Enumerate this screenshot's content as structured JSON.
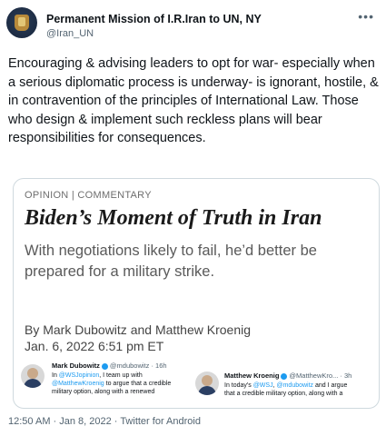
{
  "header": {
    "display_name": "Permanent Mission of I.R.Iran to UN, NY",
    "handle": "@Iran_UN",
    "more_icon": "more-horizontal-icon"
  },
  "tweet": {
    "text": "Encouraging & advising leaders to opt for war- especially when a serious diplomatic process is underway- is ignorant, hostile, & in contravention of the principles of International Law. Those who design & implement such reckless plans will bear responsibilities for consequences."
  },
  "article": {
    "section": "OPINION | COMMENTARY",
    "headline": "Biden’s Moment of Truth in Iran",
    "deck": "With negotiations likely to fail, he’d better be prepared for a military strike.",
    "byline": "By Mark Dubowitz and Matthew Kroenig",
    "date": "Jan. 6, 2022 6:51 pm ET"
  },
  "embedded": [
    {
      "name": "Mark Dubowitz",
      "meta": "@mdubowitz · 16h",
      "line1_pre": "In ",
      "line1_mention": "@WSJopinion",
      "line1_post": ", I team up with",
      "line2_mention": "@MatthewKroenig",
      "line2_post": " to argue that a credible",
      "line3": "military option, along with a renewed"
    },
    {
      "name": "Matthew Kroenig",
      "meta": "@MatthewKro... · 3h",
      "line1_pre": "In today's ",
      "line1_mention": "@WSJ",
      "line1_mid": ", ",
      "line1_mention2": "@mdubowitz",
      "line1_post": " and I argue",
      "line2": "that a credible military option, along with a"
    }
  ],
  "footer": {
    "timestamp": "12:50 AM · Jan 8, 2022 · Twitter for Android"
  },
  "colors": {
    "link": "#1d9bf0",
    "secondary": "#536471",
    "border": "#cfd9de"
  }
}
